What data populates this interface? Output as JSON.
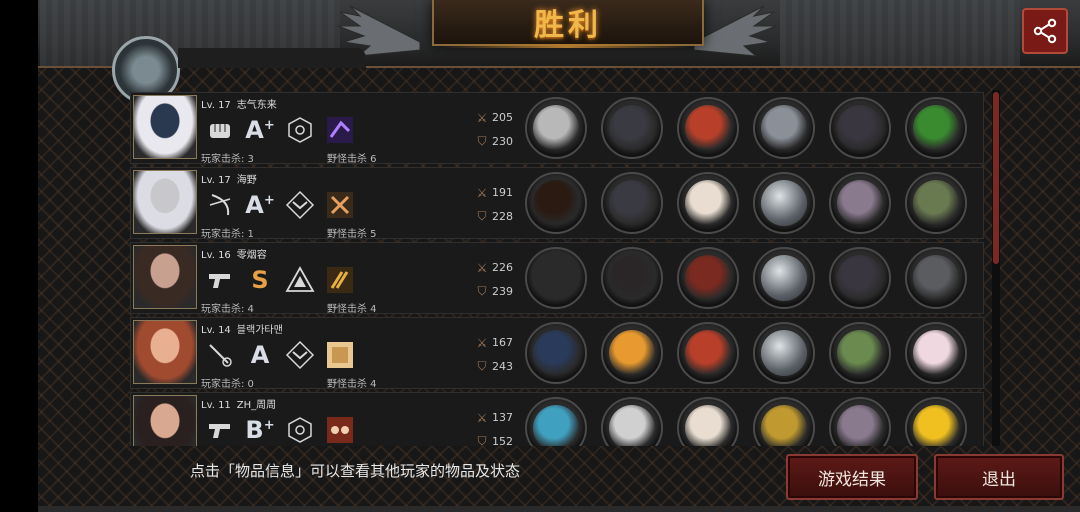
{
  "title": "胜利",
  "colors": {
    "accent_gold": "#f0b84a",
    "button_red": "#5e1a17",
    "grade_s": "#e8a046",
    "grade_a": "#d8dde6"
  },
  "header": {
    "share_icon": "share-icon"
  },
  "players": [
    {
      "level": "Lv. 17",
      "name": "志气东来",
      "skills": [
        "fist-icon",
        "grade",
        "hex-emblem-icon",
        "purple-skill-icon"
      ],
      "grade": "A",
      "grade_plus": "+",
      "player_kills": "玩家击杀: 3",
      "monster_kills": "野怪击杀 6",
      "attack": "205",
      "defense": "230",
      "items": [
        "gauntlet",
        "helmet",
        "red-armor",
        "ring-device",
        "black-boots",
        "green-orb"
      ]
    },
    {
      "level": "Lv. 17",
      "name": "海野",
      "skills": [
        "bow-icon",
        "grade",
        "chevron-emblem-icon",
        "cross-skill-icon"
      ],
      "grade": "A",
      "grade_plus": "+",
      "player_kills": "玩家击杀: 1",
      "monster_kills": "野怪击杀 5",
      "attack": "191",
      "defense": "228",
      "items": [
        "bow",
        "helmet",
        "white-armor",
        "empty-slot",
        "purple-boots",
        "green-quiver"
      ]
    },
    {
      "level": "Lv. 16",
      "name": "零烟容",
      "skills": [
        "pistol-icon",
        "grade",
        "triangle-emblem-icon",
        "bullets-skill-icon"
      ],
      "grade": "S",
      "grade_plus": "",
      "player_kills": "玩家击杀: 4",
      "monster_kills": "野怪击杀 4",
      "attack": "226",
      "defense": "239",
      "items": [
        "sniper-rifle",
        "dark-helmet",
        "red-cloak",
        "empty-slot",
        "black-boots",
        "grey-armor"
      ]
    },
    {
      "level": "Lv. 14",
      "name": "블랙가타맨",
      "skills": [
        "rapier-icon",
        "grade",
        "chevron-emblem-icon",
        "scroll-skill-icon"
      ],
      "grade": "A",
      "grade_plus": "",
      "player_kills": "玩家击杀: 0",
      "monster_kills": "野怪击杀 4",
      "attack": "167",
      "defense": "243",
      "items": [
        "dark-sword",
        "gold-wings",
        "red-armor",
        "empty-slot",
        "green-gloves",
        "pearl"
      ]
    },
    {
      "level": "Lv. 11",
      "name": "ZH_周周",
      "skills": [
        "pistol-icon",
        "grade",
        "hex-emblem-icon",
        "glasses-skill-icon"
      ],
      "grade": "B",
      "grade_plus": "+",
      "player_kills": "",
      "monster_kills": "",
      "attack": "137",
      "defense": "152",
      "items": [
        "laser-rifle",
        "glasses",
        "white-armor",
        "gold-bracelet",
        "purple-boots",
        "gold-bow"
      ]
    }
  ],
  "footer": {
    "hint": "点击「物品信息」可以查看其他玩家的物品及状态",
    "result_button": "游戏结果",
    "exit_button": "退出"
  }
}
